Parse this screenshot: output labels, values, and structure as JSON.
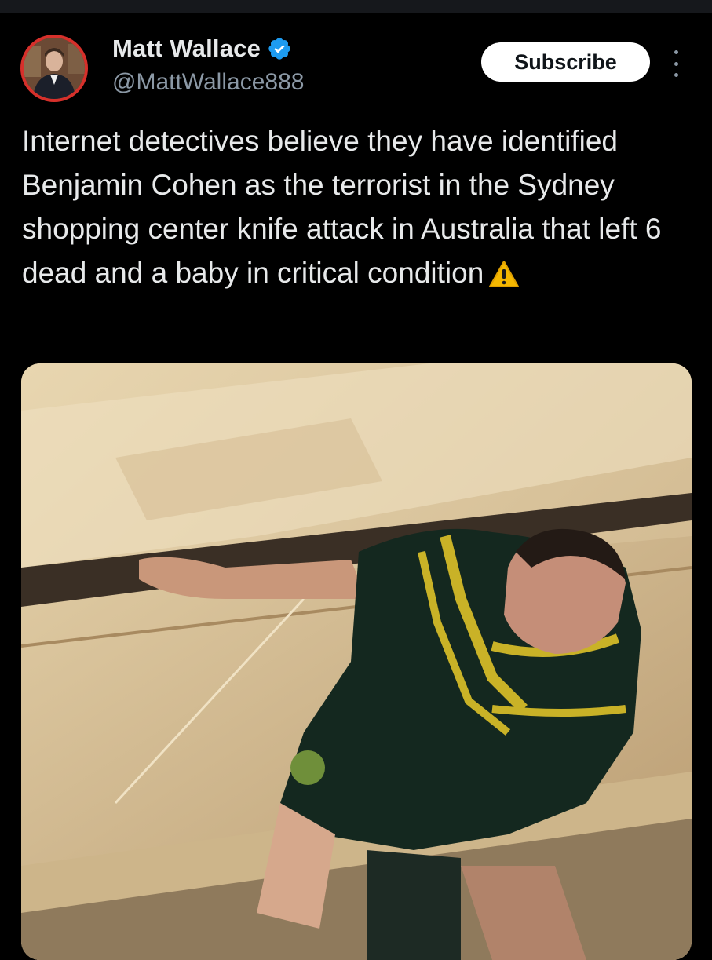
{
  "author": {
    "display_name": "Matt Wallace",
    "handle": "@MattWallace888",
    "verified": true,
    "avatar_border_color": "#d6302b"
  },
  "actions": {
    "subscribe_label": "Subscribe",
    "more_icon": "more-vertical-icon"
  },
  "tweet": {
    "text": "Internet detectives believe they have identified Benjamin Cohen as the terrorist in the Sydney shopping center knife attack in Australia that left 6 dead and a baby in critical condition",
    "trailing_emoji": "warning-icon"
  },
  "media": {
    "icon": "photo-attachment"
  },
  "colors": {
    "background": "#000000",
    "text_primary": "#e7e9ea",
    "text_secondary": "#8b98a5",
    "verified_blue": "#1d9bf0"
  }
}
